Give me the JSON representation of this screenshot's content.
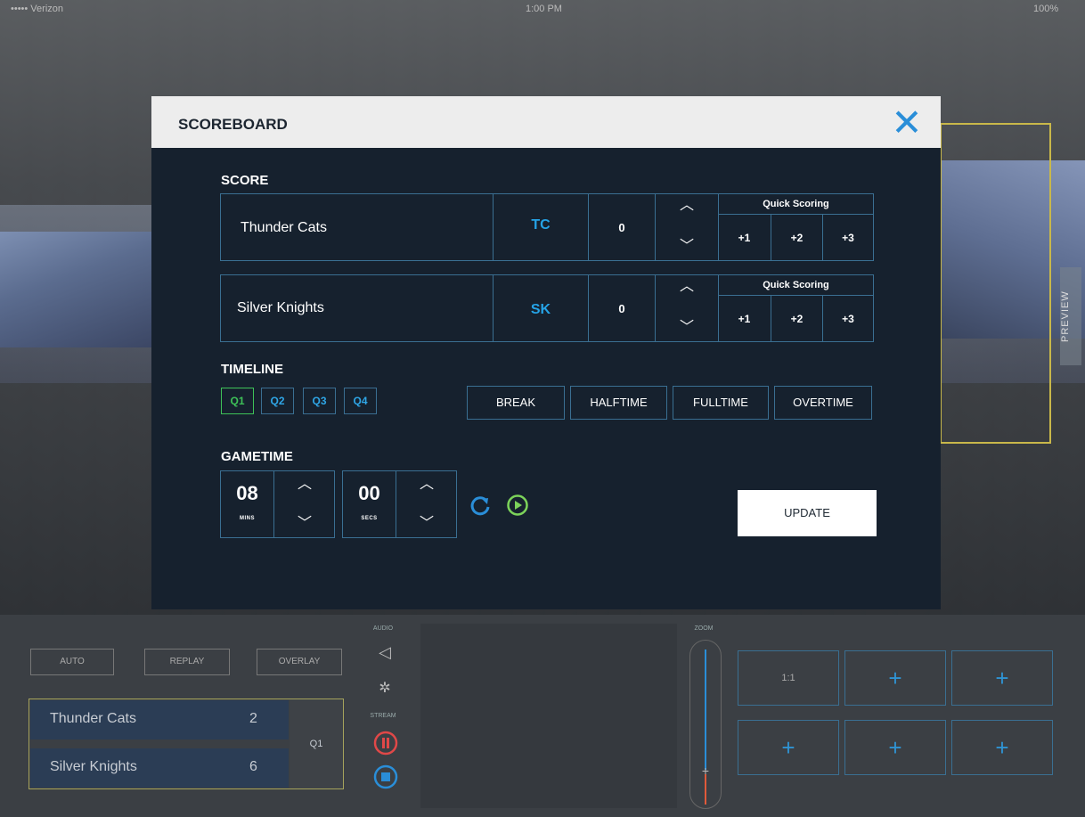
{
  "status_bar": {
    "carrier": "••••• Verizon",
    "time": "1:00 PM",
    "battery": "100%"
  },
  "preview_label": "PREVIEW",
  "modal": {
    "title": "SCOREBOARD",
    "close_icon": "close-icon",
    "score_label": "SCORE",
    "quick_scoring_label": "Quick Scoring",
    "teams": [
      {
        "name": "Thunder Cats",
        "abbr": "TC",
        "score": "0",
        "quick": [
          "+1",
          "+2",
          "+3"
        ]
      },
      {
        "name": "Silver Knights",
        "abbr": "SK",
        "score": "0",
        "quick": [
          "+1",
          "+2",
          "+3"
        ]
      }
    ],
    "timeline_label": "TIMELINE",
    "quarters": [
      "Q1",
      "Q2",
      "Q3",
      "Q4"
    ],
    "active_quarter": "Q1",
    "periods": [
      "BREAK",
      "HALFTIME",
      "FULLTIME",
      "OVERTIME"
    ],
    "gametime_label": "GAMETIME",
    "minutes": "08",
    "minutes_label": "MINS",
    "seconds": "00",
    "seconds_label": "SECS",
    "update_label": "UPDATE",
    "colors": {
      "accent": "#25a3e6",
      "active": "#3ec258",
      "bg": "#16212e",
      "border": "#3a6f92"
    }
  },
  "controls": {
    "buttons": [
      "AUTO",
      "REPLAY",
      "OVERLAY"
    ],
    "audio_label": "AUDIO",
    "stream_label": "STREAM",
    "zoom_label": "ZOOM",
    "scoreboard": [
      {
        "team": "Thunder Cats",
        "score": "2"
      },
      {
        "team": "Silver Knights",
        "score": "6"
      }
    ],
    "quarter": "Q1",
    "grid": [
      "1:1",
      "+",
      "+",
      "+",
      "+",
      "+"
    ],
    "zoom_marker": "+"
  }
}
